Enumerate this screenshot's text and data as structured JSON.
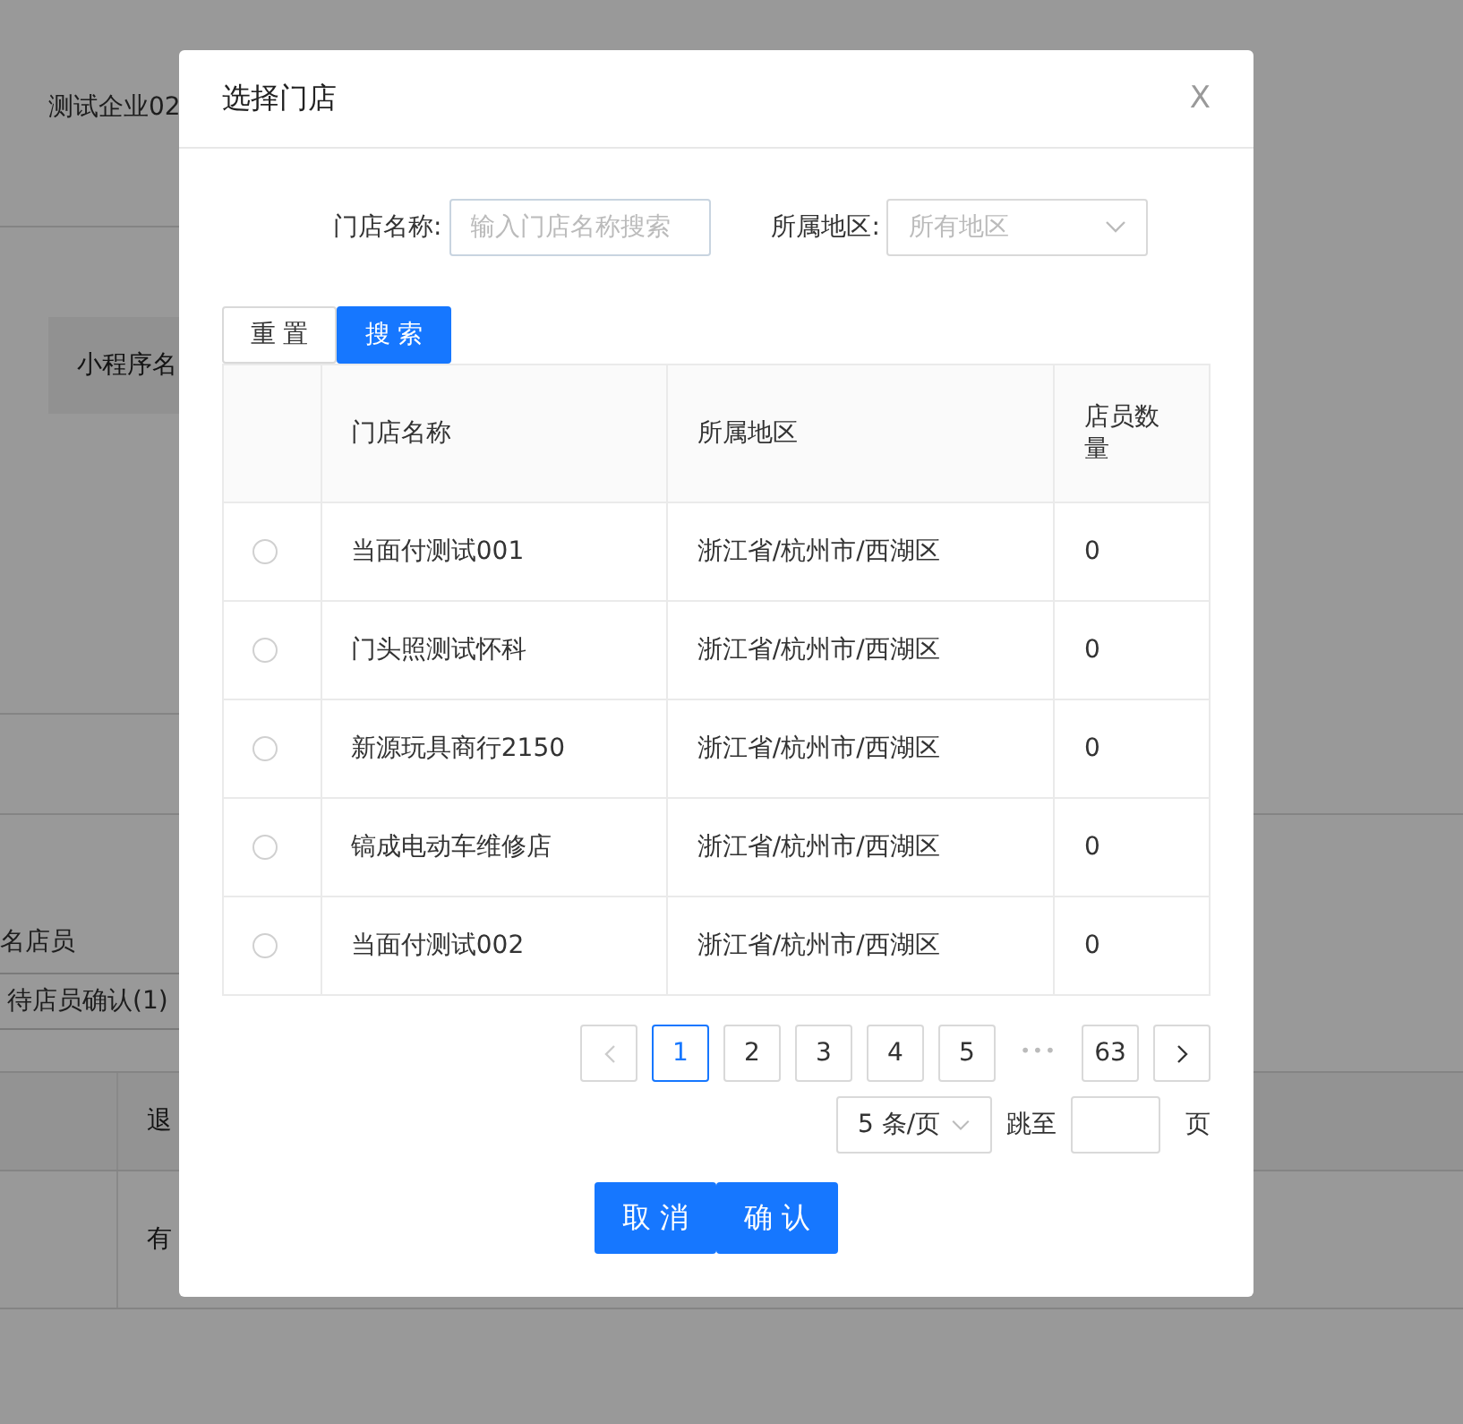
{
  "background_page": {
    "company": "测试企业02",
    "table_header": "小程序名",
    "staff_label": "名店员",
    "tab": "待店员确认(1)",
    "column_header": "退",
    "cell": "有"
  },
  "dialog": {
    "title": "选择门店",
    "close": "X",
    "filters": [
      {
        "kind": "input",
        "label": "门店名称:",
        "placeholder": "输入门店名称搜索"
      },
      {
        "kind": "select",
        "label": "所属地区:",
        "placeholder": "所有地区"
      }
    ],
    "buttons": [
      {
        "label": "重 置",
        "primary": false
      },
      {
        "label": "搜 索",
        "primary": true
      }
    ],
    "table": {
      "columns": [
        "门店名称",
        "所属地区",
        "店员数量"
      ],
      "rows": [
        {
          "selected": false,
          "cells": [
            "当面付测试001",
            "浙江省/杭州市/西湖区",
            "0"
          ]
        },
        {
          "selected": false,
          "cells": [
            "门头照测试怀科",
            "浙江省/杭州市/西湖区",
            "0"
          ]
        },
        {
          "selected": false,
          "cells": [
            "新源玩具商行2150",
            "浙江省/杭州市/西湖区",
            "0"
          ]
        },
        {
          "selected": false,
          "cells": [
            "镐成电动车维修店",
            "浙江省/杭州市/西湖区",
            "0"
          ]
        },
        {
          "selected": false,
          "cells": [
            "当面付测试002",
            "浙江省/杭州市/西湖区",
            "0"
          ]
        }
      ]
    },
    "pagination": {
      "prev_disabled": true,
      "pages": [
        {
          "label": "1",
          "selected": true
        },
        {
          "label": "2",
          "selected": false
        },
        {
          "label": "3",
          "selected": false
        },
        {
          "label": "4",
          "selected": false
        },
        {
          "label": "5",
          "selected": false
        },
        {
          "label": "•••",
          "kind": "ellipsis"
        },
        {
          "label": "63",
          "selected": false
        }
      ],
      "page_size": "5 条/页",
      "jump_label": "跳至",
      "page_unit": "页"
    },
    "footer": [
      "取 消",
      "确 认"
    ]
  }
}
